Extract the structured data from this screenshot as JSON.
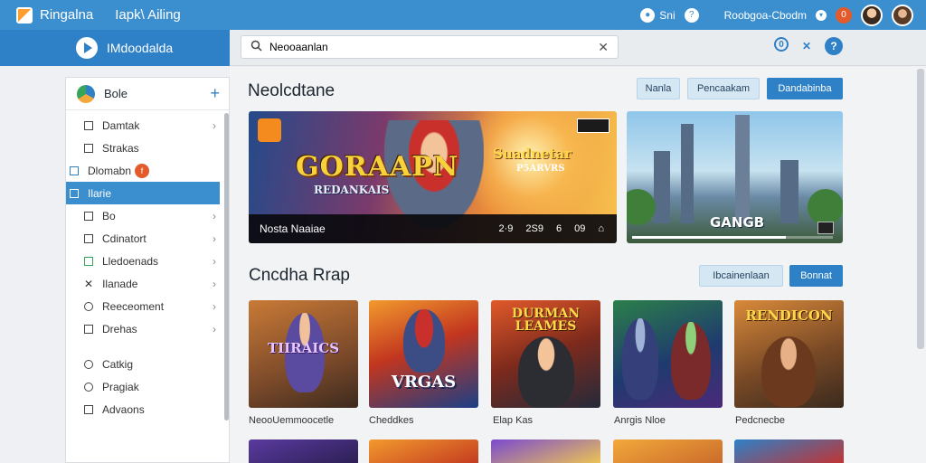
{
  "topbar": {
    "app_title": "Ringalna",
    "app_subtitle": "Iapk\\ Ailing",
    "sign_label": "Sni",
    "account_label": "Roobgoa-Cbodm",
    "notification_count": "0"
  },
  "brand": {
    "name": "IMdoodalda"
  },
  "search": {
    "value": "Neooaanlan"
  },
  "sidebar": {
    "header": "Bole",
    "items": [
      {
        "label": "Damtak",
        "chevron": true
      },
      {
        "label": "Strakas",
        "chevron": false
      },
      {
        "label": "Dlomabn",
        "badge": "f"
      },
      {
        "label": "Ilarie",
        "active": true
      },
      {
        "label": "Bo",
        "chevron": true
      },
      {
        "label": "Cdinatort",
        "chevron": true
      },
      {
        "label": "Lledoenads",
        "chevron": true
      },
      {
        "label": "Ilanade",
        "chevron": true
      },
      {
        "label": "Reeceoment",
        "chevron": true
      },
      {
        "label": "Drehas",
        "chevron": true
      },
      {
        "label": "Catkig"
      },
      {
        "label": "Pragiak"
      },
      {
        "label": "Advaons"
      }
    ]
  },
  "featured": {
    "title": "Neolcdtane",
    "buttons": [
      "Nanla",
      "Pencaakam",
      "Dandabinba"
    ],
    "hero": {
      "logo": "GORAAPN",
      "logo_sub": "REDANKAIS",
      "right_title": "Suadnetar",
      "right_sub": "P5ARVRS",
      "caption": "Nosta Naaiae",
      "controls": [
        "2·9",
        "2S9",
        "6",
        "09",
        "⌂"
      ]
    },
    "second": {
      "logo": "GANGB"
    }
  },
  "section": {
    "title": "Cncdha Rrap",
    "buttons": [
      "Ibcainenlaan",
      "Bonnat"
    ]
  },
  "games": [
    {
      "art": "TIIRAICS",
      "label": "NeooUemmoocetle"
    },
    {
      "art": "VRGAS",
      "label": "Cheddkes"
    },
    {
      "art": "DURMAN LEAMES",
      "label": "Elap Kas"
    },
    {
      "art": "",
      "label": "Anrgis Nloe"
    },
    {
      "art": "RENDICON",
      "label": "Pedcnecbe"
    }
  ],
  "colors": {
    "accent": "#2e80c7",
    "topbar": "#3c8fcf",
    "badge": "#e35b2b"
  }
}
